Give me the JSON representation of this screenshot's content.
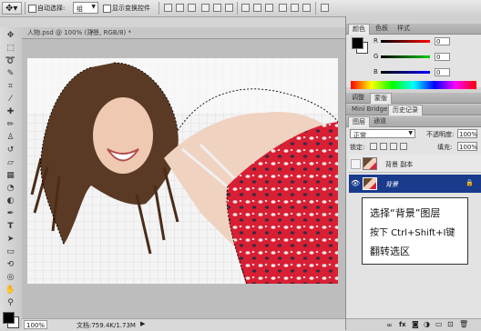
{
  "options_bar": {
    "auto_select_label": "自动选择:",
    "auto_select_value": "组",
    "show_transform_label": "显示变换控件"
  },
  "document": {
    "tab_title": "人物.psd @ 100% (背景, RGB/8) *",
    "zoom": "100%",
    "doc_info": "文档:759.4K/1.73M"
  },
  "color_panel": {
    "tabs": [
      "颜色",
      "色板",
      "样式"
    ],
    "channels": [
      {
        "name": "R",
        "value": "0",
        "color": "#e02020"
      },
      {
        "name": "G",
        "value": "0",
        "color": "#20b020"
      },
      {
        "name": "B",
        "value": "0",
        "color": "#2040e0"
      }
    ]
  },
  "history_panel": {
    "tabs": [
      "调整",
      "蒙版"
    ]
  },
  "minibridge_panel": {
    "tabs": [
      "Mini Bridge",
      "历史记录"
    ]
  },
  "layers_panel": {
    "tabs": [
      "图层",
      "通道"
    ],
    "blend_mode": "正常",
    "opacity_label": "不透明度:",
    "opacity_value": "100%",
    "lock_label": "锁定:",
    "fill_label": "填充:",
    "fill_value": "100%",
    "layers": [
      {
        "name": "背景 副本",
        "selected": false
      },
      {
        "name": "背景",
        "selected": true
      }
    ]
  },
  "callout": {
    "line1": "选择“背景”图层",
    "line2": "按下 Ctrl+Shift+I键",
    "line3": "翻转选区"
  },
  "colors": {
    "selected_layer": "#1a3a8c",
    "dress": "#d81f34"
  }
}
